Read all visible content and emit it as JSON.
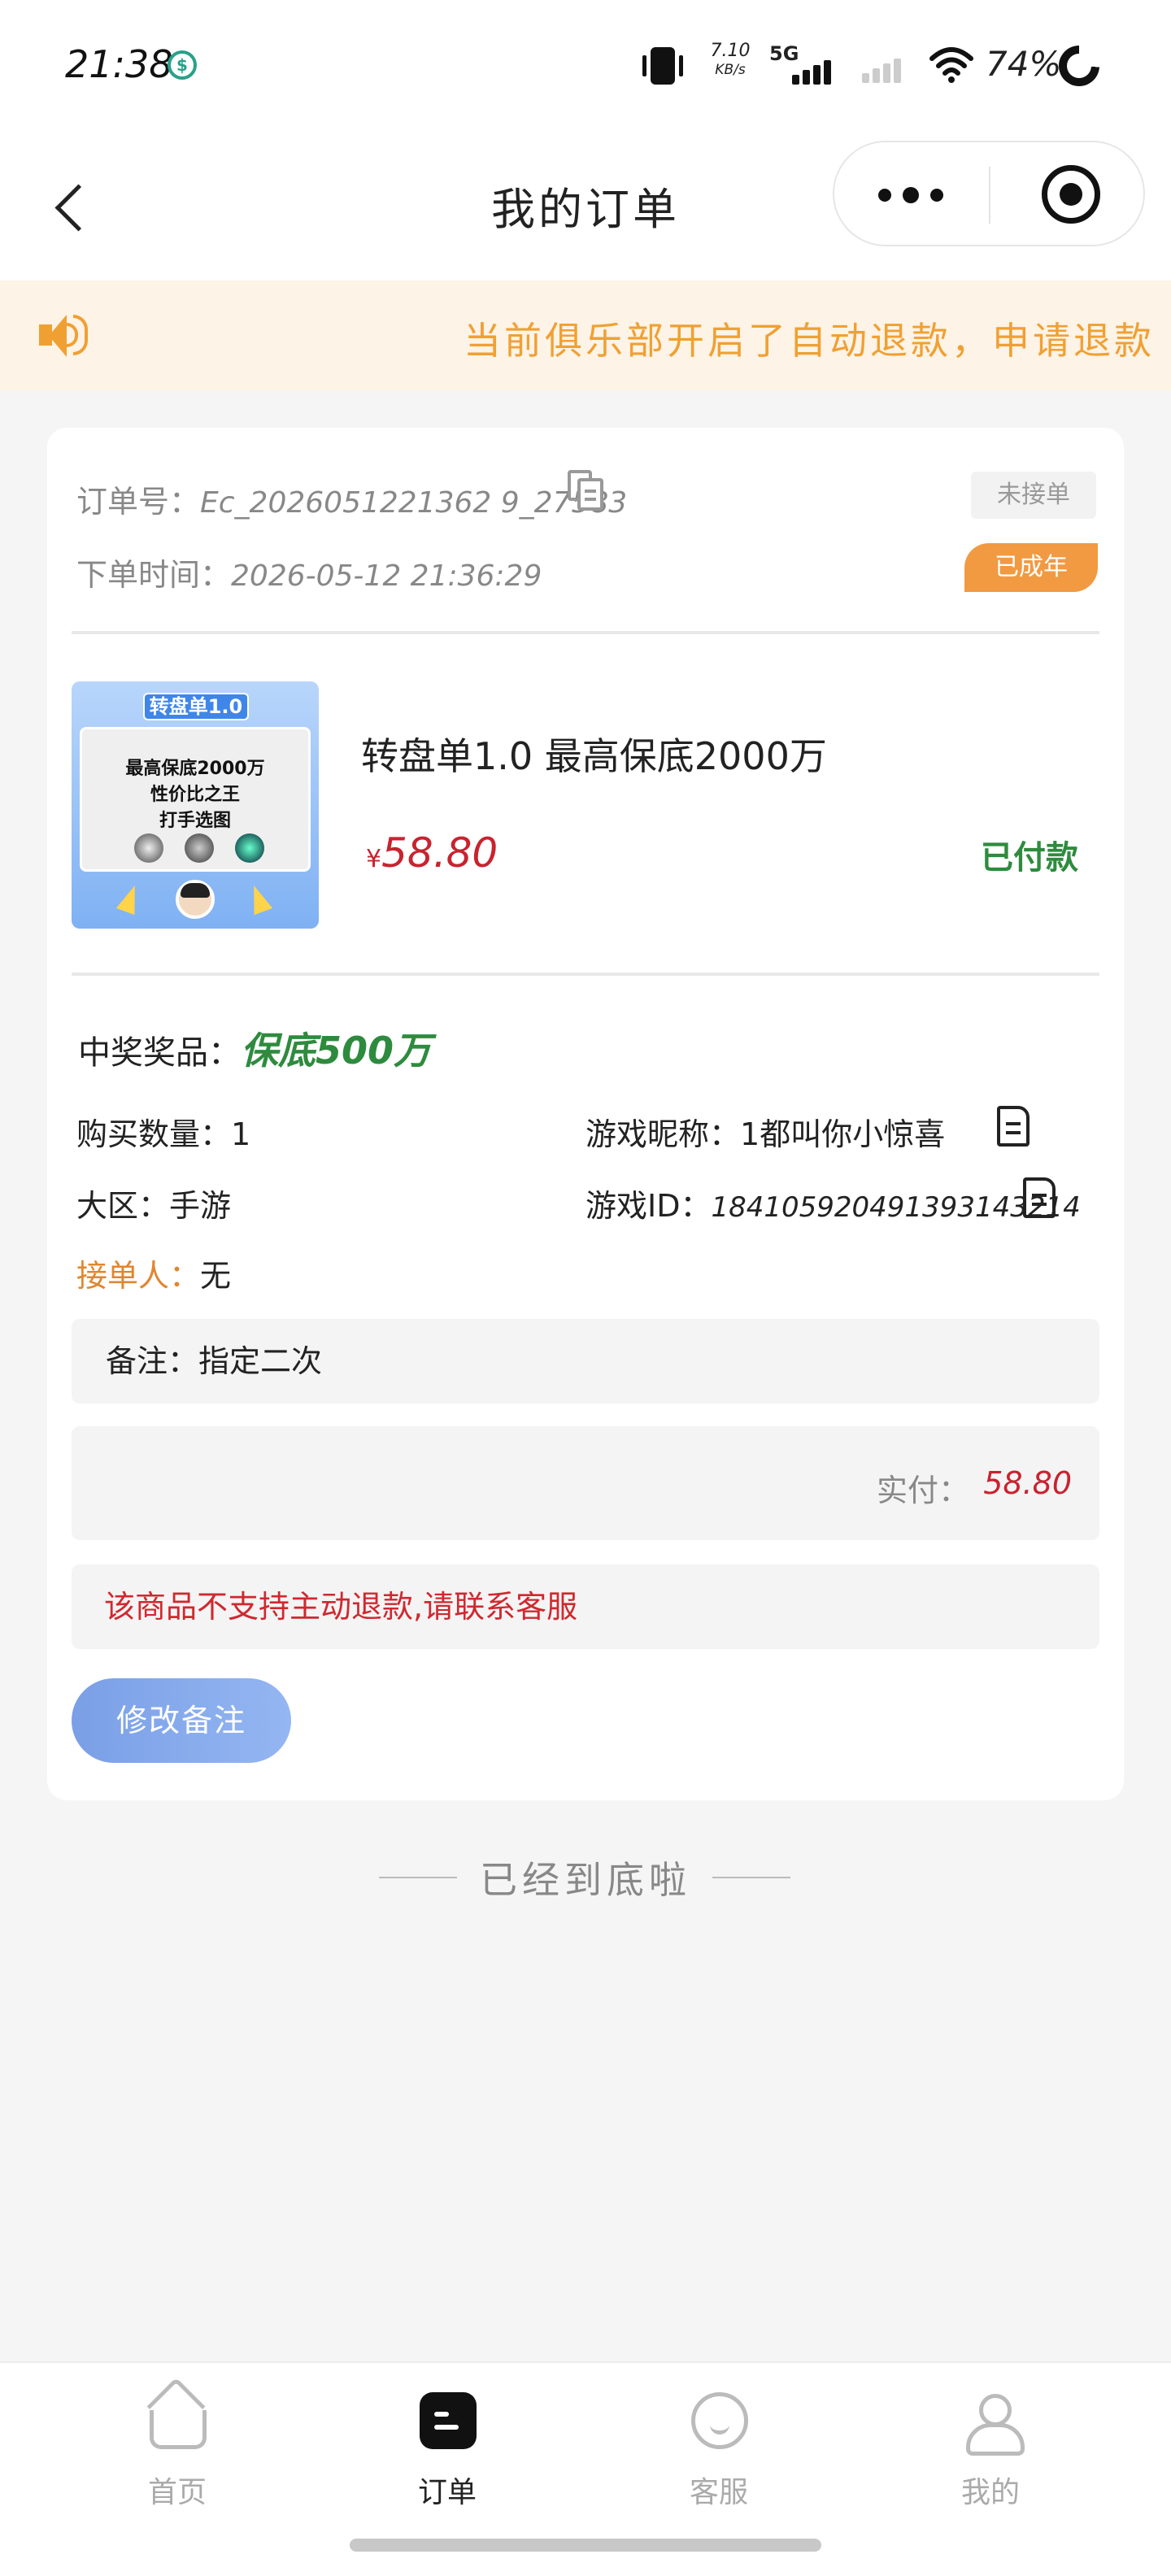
{
  "status_bar": {
    "time": "21:38",
    "hk_icon": "hongkong-dollar-icon",
    "net_speed": "7.10",
    "net_unit": "KB/s",
    "network": "5G",
    "battery": "74%"
  },
  "nav": {
    "title": "我的订单",
    "back_icon": "chevron-left-icon",
    "more_icon": "more-dots-icon",
    "close_icon": "target-icon"
  },
  "notice": {
    "icon": "speaker-icon",
    "text": "当前俱乐部开启了自动退款，申请退款"
  },
  "order": {
    "number_label": "订单号：",
    "number": "Ec_2026051221362 9_27583",
    "status_badge": "未接单",
    "time_label": "下单时间：",
    "time": "2026-05-12 21:36:29",
    "done_badge": "已成年",
    "product": {
      "image_banner": "转盘单1.0",
      "image_line1": "最高保底2000万",
      "image_line2": "性价比之王",
      "image_line3": "打手选图",
      "name": "转盘单1.0 最高保底2000万",
      "currency": "¥",
      "price": "58.80",
      "pay_status": "已付款"
    },
    "prize_label": "中奖奖品：",
    "prize": "保底500万",
    "qty_label": "购买数量：",
    "qty": "1",
    "nickname_label": "游戏昵称：",
    "nickname": "1都叫你小惊喜",
    "region_label": "大区：",
    "region": "手游",
    "game_id_label": "游戏ID：",
    "game_id": "184105920491393143214",
    "taker_label": "接单人：",
    "taker": "无",
    "remark_label": "备注：",
    "remark": "指定二次",
    "paid_label": "实付：",
    "paid": "58.80",
    "refund_note": "该商品不支持主动退款,请联系客服",
    "edit_button": "修改备注"
  },
  "bottom_tip": "已经到底啦",
  "tabs": [
    {
      "label": "首页",
      "icon": "home-icon",
      "active": false
    },
    {
      "label": "订单",
      "icon": "order-icon",
      "active": true
    },
    {
      "label": "客服",
      "icon": "customer-service-icon",
      "active": false
    },
    {
      "label": "我的",
      "icon": "user-icon",
      "active": false
    }
  ]
}
